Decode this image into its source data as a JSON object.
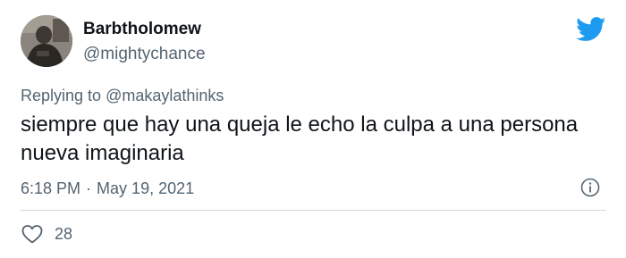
{
  "user": {
    "display_name": "Barbtholomew",
    "handle": "@mightychance"
  },
  "reply": {
    "prefix": "Replying to",
    "mention": "@makaylathinks"
  },
  "tweet": {
    "text": "siempre que hay una queja le echo la culpa a una persona nueva imaginaria",
    "time": "6:18 PM",
    "separator": "·",
    "date": "May 19, 2021",
    "likes": "28"
  },
  "icons": {
    "logo": "twitter-bird-icon",
    "info": "info-icon",
    "like": "heart-icon"
  },
  "colors": {
    "brand": "#1d9bf0",
    "secondary_text": "#536471",
    "primary_text": "#0f1419",
    "divider": "#cfd9de"
  }
}
